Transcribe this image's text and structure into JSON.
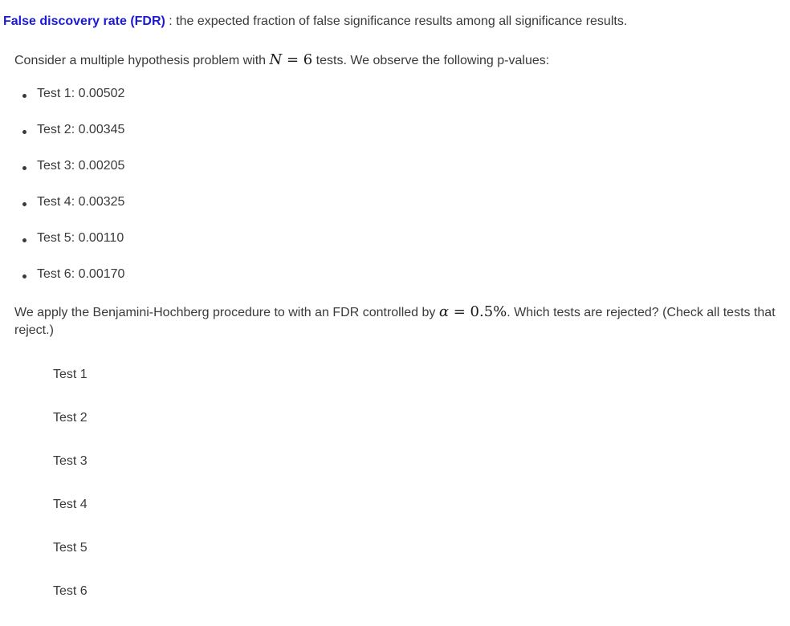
{
  "definition": {
    "term": "False discovery rate (FDR)",
    "text": " : the expected fraction of false significance results among all significance results."
  },
  "intro": {
    "prefix": "Consider a multiple hypothesis problem with ",
    "math_var": "N",
    "math_rest": " = 6",
    "suffix": " tests. We observe the following p-values:"
  },
  "pvalues": [
    "Test 1: 0.00502",
    "Test 2: 0.00345",
    "Test 3: 0.00205",
    "Test 4: 0.00325",
    "Test 5: 0.00110",
    "Test 6: 0.00170"
  ],
  "question": {
    "prefix": "We apply the Benjamini-Hochberg procedure to with an FDR controlled by ",
    "math_var": "α",
    "math_rest": " = 0.5%",
    "suffix": ". Which tests are rejected? (Check all tests that reject.)"
  },
  "options": [
    "Test 1",
    "Test 2",
    "Test 3",
    "Test 4",
    "Test 5",
    "Test 6"
  ]
}
